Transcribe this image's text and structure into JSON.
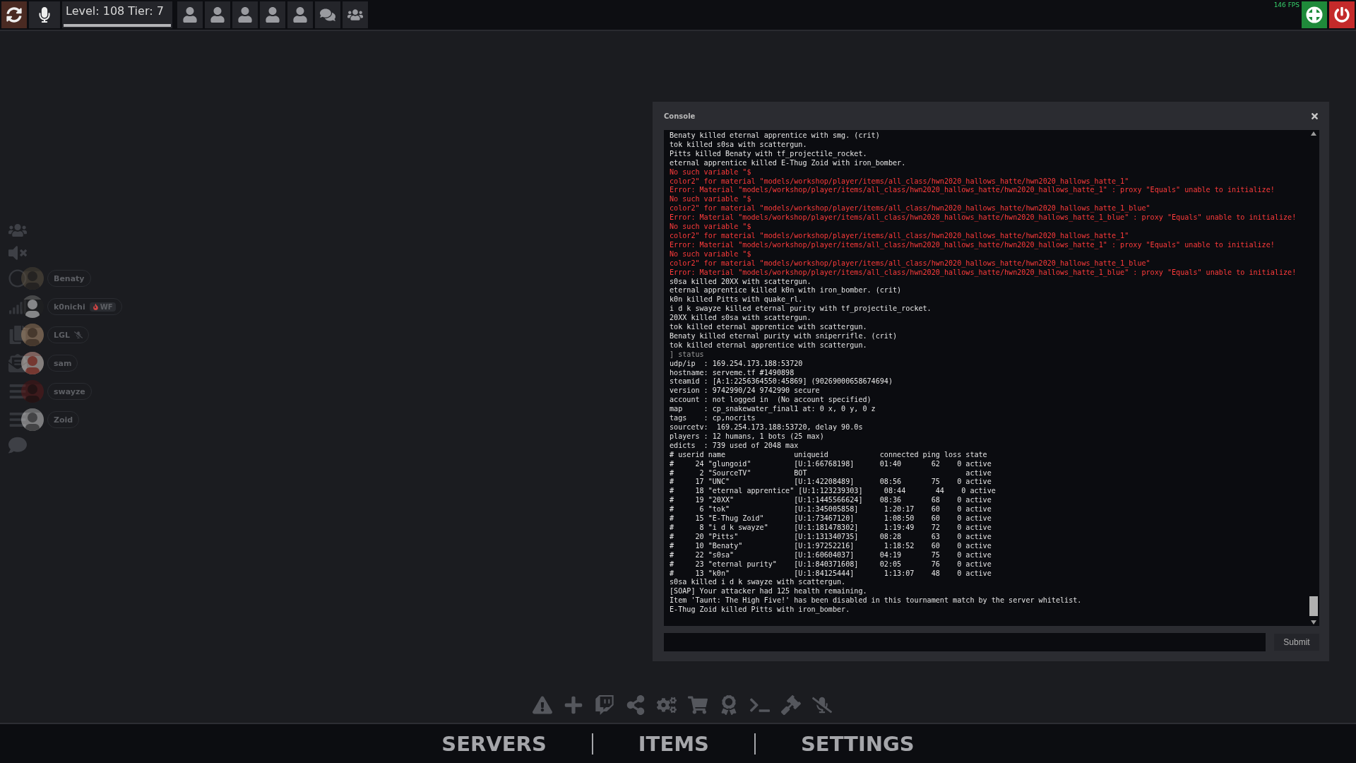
{
  "top_bar": {
    "level_text": "Level: 108 Tier: 7",
    "level": 1,
    "fps": "146 FPS",
    "buttons": [
      {
        "kind": "user"
      },
      {
        "kind": "user"
      },
      {
        "kind": "user"
      },
      {
        "kind": "user"
      },
      {
        "kind": "user"
      },
      {
        "kind": "chat"
      },
      {
        "kind": "group"
      }
    ]
  },
  "sidebar": {
    "players": [
      {
        "name": "Benaty",
        "kind": "circle"
      },
      {
        "name": "k0nichi",
        "kind": "bars",
        "badge": "WF"
      },
      {
        "name": "LGL",
        "kind": "copy",
        "muted": true
      },
      {
        "name": "sam",
        "kind": "mail"
      },
      {
        "name": "swayze",
        "kind": "list"
      },
      {
        "name": "Zoid",
        "kind": "list"
      }
    ]
  },
  "console": {
    "title": "Console",
    "lines": [
      {
        "kind": "normal",
        "text": "Benaty killed eternal apprentice with smg. (crit)"
      },
      {
        "kind": "normal",
        "text": "tok killed s0sa with scattergun."
      },
      {
        "kind": "normal",
        "text": "Pitts killed Benaty with tf_projectile_rocket."
      },
      {
        "kind": "normal",
        "text": "eternal apprentice killed E-Thug Zoid with iron_bomber."
      },
      {
        "kind": "error",
        "text": "No such variable \"$"
      },
      {
        "kind": "error",
        "text": "color2\" for material \"models/workshop/player/items/all_class/hwn2020_hallows_hatte/hwn2020_hallows_hatte_1\""
      },
      {
        "kind": "error",
        "text": "Error: Material \"models/workshop/player/items/all_class/hwn2020_hallows_hatte/hwn2020_hallows_hatte_1\" : proxy \"Equals\" unable to initialize!"
      },
      {
        "kind": "error",
        "text": "No such variable \"$"
      },
      {
        "kind": "error",
        "text": "color2\" for material \"models/workshop/player/items/all_class/hwn2020_hallows_hatte/hwn2020_hallows_hatte_1_blue\""
      },
      {
        "kind": "error",
        "text": "Error: Material \"models/workshop/player/items/all_class/hwn2020_hallows_hatte/hwn2020_hallows_hatte_1_blue\" : proxy \"Equals\" unable to initialize!"
      },
      {
        "kind": "error",
        "text": "No such variable \"$"
      },
      {
        "kind": "error",
        "text": "color2\" for material \"models/workshop/player/items/all_class/hwn2020_hallows_hatte/hwn2020_hallows_hatte_1\""
      },
      {
        "kind": "error",
        "text": "Error: Material \"models/workshop/player/items/all_class/hwn2020_hallows_hatte/hwn2020_hallows_hatte_1\" : proxy \"Equals\" unable to initialize!"
      },
      {
        "kind": "error",
        "text": "No such variable \"$"
      },
      {
        "kind": "error",
        "text": "color2\" for material \"models/workshop/player/items/all_class/hwn2020_hallows_hatte/hwn2020_hallows_hatte_1_blue\""
      },
      {
        "kind": "error",
        "text": "Error: Material \"models/workshop/player/items/all_class/hwn2020_hallows_hatte/hwn2020_hallows_hatte_1_blue\" : proxy \"Equals\" unable to initialize!"
      },
      {
        "kind": "normal",
        "text": "s0sa killed 20XX with scattergun."
      },
      {
        "kind": "normal",
        "text": "eternal apprentice killed k0n with iron_bomber. (crit)"
      },
      {
        "kind": "normal",
        "text": "k0n killed Pitts with quake_rl."
      },
      {
        "kind": "normal",
        "text": "i d k swayze killed eternal purity with tf_projectile_rocket."
      },
      {
        "kind": "normal",
        "text": "20XX killed s0sa with scattergun."
      },
      {
        "kind": "normal",
        "text": "tok killed eternal apprentice with scattergun."
      },
      {
        "kind": "normal",
        "text": "Benaty killed eternal purity with sniperrifle. (crit)"
      },
      {
        "kind": "normal",
        "text": "tok killed eternal apprentice with scattergun."
      },
      {
        "kind": "command",
        "text": "] status"
      },
      {
        "kind": "normal",
        "text": "udp/ip  : 169.254.173.188:53720"
      },
      {
        "kind": "normal",
        "text": "hostname: serveme.tf #1490898"
      },
      {
        "kind": "normal",
        "text": "steamid : [A:1:2256364550:45869] (90269000658674694)"
      },
      {
        "kind": "normal",
        "text": "version : 9742990/24 9742990 secure"
      },
      {
        "kind": "normal",
        "text": "account : not logged in  (No account specified)"
      },
      {
        "kind": "normal",
        "text": "map     : cp_snakewater_final1 at: 0 x, 0 y, 0 z"
      },
      {
        "kind": "normal",
        "text": "tags    : cp,nocrits"
      },
      {
        "kind": "normal",
        "text": "sourcetv:  169.254.173.188:53720, delay 90.0s"
      },
      {
        "kind": "normal",
        "text": "players : 12 humans, 1 bots (25 max)"
      },
      {
        "kind": "normal",
        "text": "edicts  : 739 used of 2048 max"
      },
      {
        "kind": "normal",
        "text": "# userid name                uniqueid            connected ping loss state"
      },
      {
        "kind": "normal",
        "text": "#     24 \"glungoid\"          [U:1:66768198]      01:40       62    0 active"
      },
      {
        "kind": "normal",
        "text": "#      2 \"SourceTV\"          BOT                                     active"
      },
      {
        "kind": "normal",
        "text": "#     17 \"UNC\"               [U:1:42208489]      08:56       75    0 active"
      },
      {
        "kind": "normal",
        "text": "#     18 \"eternal apprentice\" [U:1:123239303]     08:44       44    0 active"
      },
      {
        "kind": "normal",
        "text": "#     19 \"20XX\"              [U:1:1445566624]    08:36       68    0 active"
      },
      {
        "kind": "normal",
        "text": "#      6 \"tok\"               [U:1:345005858]      1:20:17    60    0 active"
      },
      {
        "kind": "normal",
        "text": "#     15 \"E-Thug Zoid\"       [U:1:73467120]       1:08:50    60    0 active"
      },
      {
        "kind": "normal",
        "text": "#      8 \"i d k swayze\"      [U:1:181478302]      1:19:49    72    0 active"
      },
      {
        "kind": "normal",
        "text": "#     20 \"Pitts\"             [U:1:131340735]     08:28       63    0 active"
      },
      {
        "kind": "normal",
        "text": "#     10 \"Benaty\"            [U:1:97252216]       1:18:52    60    0 active"
      },
      {
        "kind": "normal",
        "text": "#     22 \"s0sa\"              [U:1:60604037]      04:19       75    0 active"
      },
      {
        "kind": "normal",
        "text": "#     23 \"eternal purity\"    [U:1:840371608]     02:05       76    0 active"
      },
      {
        "kind": "normal",
        "text": "#     13 \"k0n\"               [U:1:84125444]       1:13:07    48    0 active"
      },
      {
        "kind": "normal",
        "text": "s0sa killed i d k swayze with scattergun."
      },
      {
        "kind": "normal",
        "text": "[SOAP] Your attacker had 125 health remaining."
      },
      {
        "kind": "normal",
        "text": "Item 'Taunt: The High Five!' has been disabled in this tournament match by the server whitelist."
      },
      {
        "kind": "normal",
        "text": "E-Thug Zoid killed Pitts with iron_bomber."
      }
    ],
    "submit": "Submit"
  },
  "toolbar": [
    {
      "kind": "warning"
    },
    {
      "kind": "plus"
    },
    {
      "kind": "stream"
    },
    {
      "kind": "share"
    },
    {
      "kind": "gears"
    },
    {
      "kind": "cart"
    },
    {
      "kind": "award"
    },
    {
      "kind": "terminal"
    },
    {
      "kind": "gavel"
    },
    {
      "kind": "mic-off"
    }
  ],
  "nav": [
    {
      "label": "SERVERS"
    },
    {
      "label": "ITEMS"
    },
    {
      "label": "SETTINGS"
    }
  ]
}
